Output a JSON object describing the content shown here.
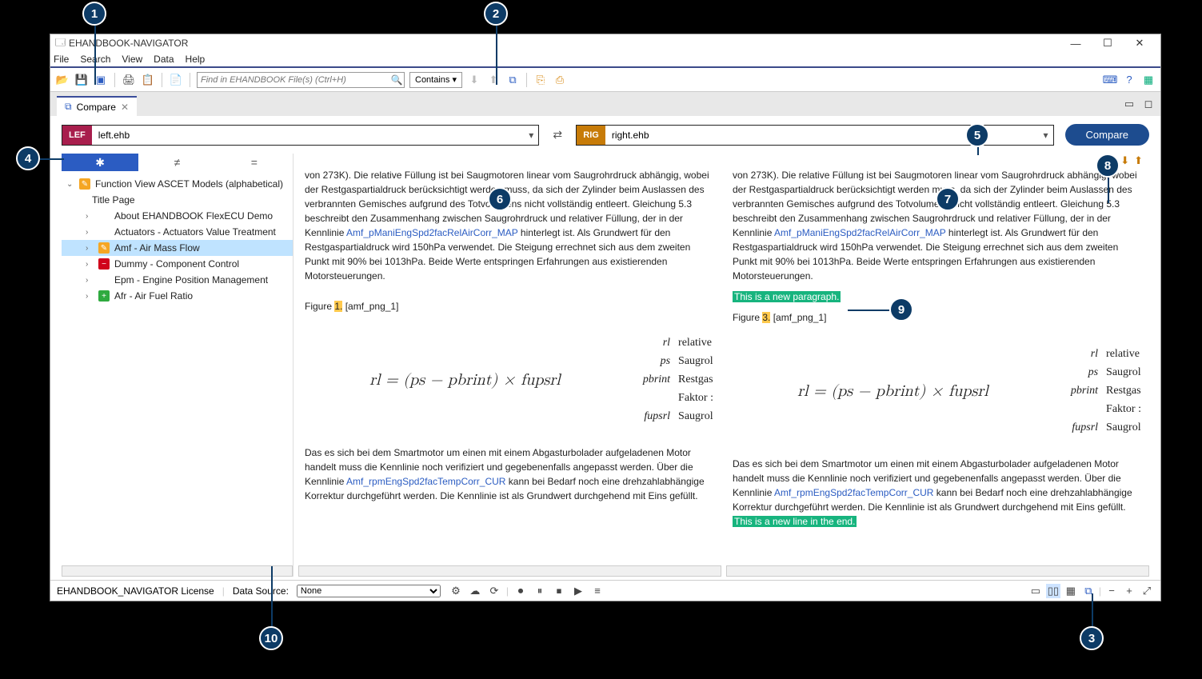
{
  "window": {
    "title": "EHANDBOOK-NAVIGATOR"
  },
  "menu": {
    "file": "File",
    "search": "Search",
    "view": "View",
    "data": "Data",
    "help": "Help"
  },
  "toolbar": {
    "search_placeholder": "Find in EHANDBOOK File(s) (Ctrl+H)",
    "contains": "Contains ▾"
  },
  "tab": {
    "label": "Compare"
  },
  "files": {
    "left_tag": "LEF",
    "left_name": "left.ehb",
    "right_tag": "RIG",
    "right_name": "right.ehb",
    "compare_btn": "Compare"
  },
  "filters": {
    "all": "✱",
    "diff": "≠",
    "same": "="
  },
  "tree": {
    "root": "Function View ASCET Models (alphabetical)",
    "title_page": "Title Page",
    "items": [
      {
        "label": "About EHANDBOOK FlexECU Demo"
      },
      {
        "label": "Actuators - Actuators Value Treatment"
      },
      {
        "label": "Amf - Air Mass Flow",
        "badge": "edit",
        "selected": true
      },
      {
        "label": "Dummy - Component Control",
        "badge": "minus"
      },
      {
        "label": "Epm - Engine Position Management"
      },
      {
        "label": "Afr - Air Fuel Ratio",
        "badge": "plus"
      }
    ]
  },
  "doc": {
    "para1_prefix": "von 273K). Die relative Füllung ist bei Saugmotoren linear vom Saugrohrdruck abhängig, wobei der Restgaspartialdruck berücksichtigt werden muss, da sich der Zylinder beim Auslassen des verbrannten Gemisches aufgrund des Totvolumens nicht vollständig entleert. Gleichung 5.3 beschreibt den Zusammenhang zwischen Saugrohrdruck und relativer Füllung, der in der Kennlinie ",
    "link1": "Amf_pManiEngSpd2facRelAirCorr_MAP",
    "para1_suffix": " hinterlegt ist. Als Grundwert für den Restgaspartialdruck wird 150hPa verwendet. Die Steigung errechnet sich aus dem zweiten Punkt mit 90% bei 1013hPa. Beide Werte entspringen Erfahrungen aus existierenden Motorsteuerungen.",
    "right_new_para": "This is a new paragraph.",
    "fig_label": "Figure ",
    "fig_num_left": "1.",
    "fig_num_right": "3.",
    "fig_name": " [amf_png_1]",
    "formula": "rl = (ps − pbrint) × fupsrl",
    "legend": [
      [
        "rl",
        "relative"
      ],
      [
        "ps",
        "Saugrol"
      ],
      [
        "pbrint",
        "Restgas"
      ],
      [
        "",
        "Faktor :"
      ],
      [
        "fupsrl",
        "Saugrol"
      ]
    ],
    "para2_prefix": " Das es sich bei dem Smartmotor um einen mit einem Abgasturbolader aufgeladenen Motor handelt muss die Kennlinie noch verifiziert und gegebenenfalls angepasst werden. Über die Kennlinie ",
    "link2": "Amf_rpmEngSpd2facTempCorr_CUR",
    "para2_suffix": " kann bei Bedarf noch eine drehzahlabhängige Korrektur durchgeführt werden. Die Kennlinie ist als Grundwert durchgehend mit Eins gefüllt.",
    "right_new_line": "This is a new line in the end."
  },
  "status": {
    "license": "EHANDBOOK_NAVIGATOR License",
    "data_source_label": "Data Source:",
    "data_source_value": "None"
  }
}
